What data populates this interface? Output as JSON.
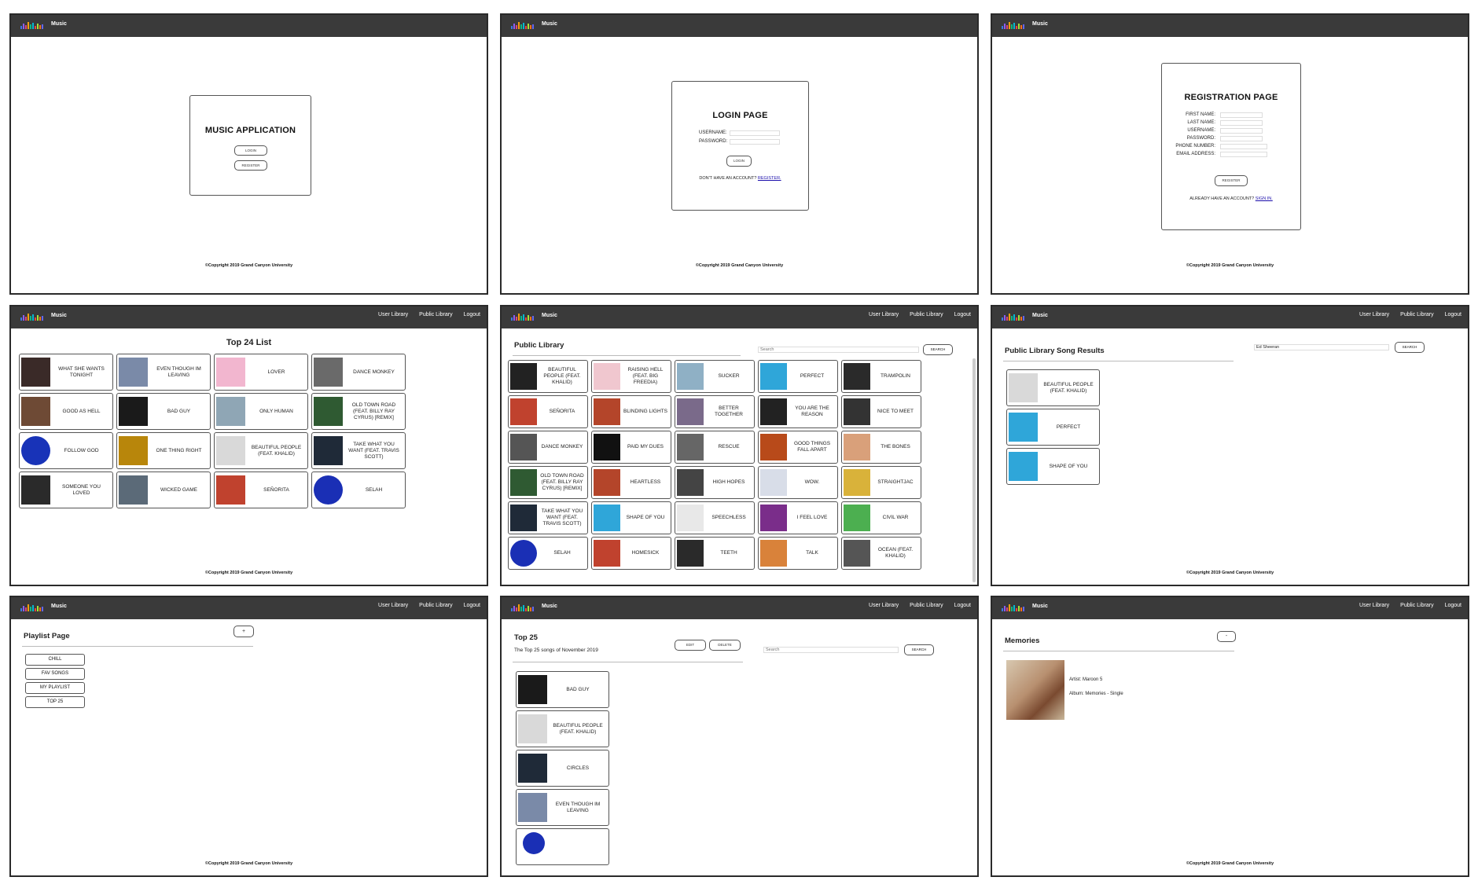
{
  "brand": "Music",
  "nav": [
    "User Library",
    "Public Library",
    "Logout"
  ],
  "footer": "©Copyright 2019 Grand Canyon University",
  "logo_colors": [
    "#3b7ae0",
    "#8b5cf6",
    "#e0457b",
    "#f59e0b",
    "#10b981",
    "#06b6d4",
    "#ef4444",
    "#a3e635",
    "#f97316",
    "#6366f1"
  ],
  "home": {
    "title": "MUSIC APPLICATION",
    "login": "LOGIN",
    "register": "REGISTER"
  },
  "login": {
    "title": "LOGIN PAGE",
    "fields": [
      "USERNAME:",
      "PASSWORD:"
    ],
    "button": "LOGIN",
    "note": "DON'T HAVE AN ACCOUNT?",
    "link": "REGISTER."
  },
  "registration": {
    "title": "REGISTRATION PAGE",
    "fields": [
      "FIRST NAME:",
      "LAST NAME:",
      "USERNAME:",
      "PASSWORD:",
      "PHONE NUMBER:",
      "EMAIL ADDRESS:"
    ],
    "button": "REGISTER",
    "note": "ALREADY HAVE AN ACCOUNT?",
    "link": "SIGN IN."
  },
  "top24": {
    "title": "Top 24 List",
    "songs": [
      {
        "name": "WHAT SHE WANTS TONIGHT",
        "color": "#3a2a28"
      },
      {
        "name": "EVEN THOUGH IM LEAVING",
        "color": "#7a8aa8"
      },
      {
        "name": "LOVER",
        "color": "#f2b6cf"
      },
      {
        "name": "DANCE MONKEY",
        "color": "#6a6a6a"
      },
      {
        "name": "GOOD AS HELL",
        "color": "#6e4a35"
      },
      {
        "name": "BAD GUY",
        "color": "#1a1a1a"
      },
      {
        "name": "ONLY HUMAN",
        "color": "#8fa6b5"
      },
      {
        "name": "OLD TOWN ROAD (FEAT. BILLY RAY CYRUS) [REMIX]",
        "color": "#2f5a32"
      },
      {
        "name": "FOLLOW GOD",
        "color": "#1833b8"
      },
      {
        "name": "ONE THING RIGHT",
        "color": "#b8860b"
      },
      {
        "name": "BEAUTIFUL PEOPLE (FEAT. KHALID)",
        "color": "#d9d9d9"
      },
      {
        "name": "TAKE WHAT YOU WANT (FEAT. TRAVIS SCOTT)",
        "color": "#1f2a38"
      },
      {
        "name": "SOMEONE YOU LOVED",
        "color": "#2a2a2a"
      },
      {
        "name": "WICKED GAME",
        "color": "#5b6a78"
      },
      {
        "name": "SEÑORITA",
        "color": "#c0422e"
      },
      {
        "name": "SELAH",
        "color": "#1a2fb5"
      }
    ]
  },
  "public_library": {
    "title": "Public Library",
    "search_placeholder": "Search",
    "search_button": "SEARCH",
    "songs": [
      {
        "name": "BEAUTIFUL PEOPLE (FEAT. KHALID)",
        "color": "#222"
      },
      {
        "name": "RAISING HELL (FEAT. BIG FREEDIA)",
        "color": "#f0c7cf"
      },
      {
        "name": "SUCKER",
        "color": "#8fb0c5"
      },
      {
        "name": "PERFECT",
        "color": "#2fa6d9"
      },
      {
        "name": "TRAMPOLIN",
        "color": "#2a2a2a"
      },
      {
        "name": "SEÑORITA",
        "color": "#c0422e"
      },
      {
        "name": "BLINDING LIGHTS",
        "color": "#b4452a"
      },
      {
        "name": "BETTER TOGETHER",
        "color": "#7a6a8a"
      },
      {
        "name": "YOU ARE THE REASON",
        "color": "#222"
      },
      {
        "name": "NICE TO MEET",
        "color": "#333"
      },
      {
        "name": "DANCE MONKEY",
        "color": "#555"
      },
      {
        "name": "PAID MY DUES",
        "color": "#111"
      },
      {
        "name": "RESCUE",
        "color": "#666"
      },
      {
        "name": "GOOD THINGS FALL APART",
        "color": "#b84a1a"
      },
      {
        "name": "THE BONES",
        "color": "#d9a07a"
      },
      {
        "name": "OLD TOWN ROAD (FEAT. BILLY RAY CYRUS) [REMIX]",
        "color": "#2f5a32"
      },
      {
        "name": "HEARTLESS",
        "color": "#b4452a"
      },
      {
        "name": "HIGH HOPES",
        "color": "#444"
      },
      {
        "name": "WOW.",
        "color": "#d8dde8"
      },
      {
        "name": "STRAIGHTJAC",
        "color": "#d9b23a"
      },
      {
        "name": "TAKE WHAT YOU WANT (FEAT. TRAVIS SCOTT)",
        "color": "#1f2a38"
      },
      {
        "name": "SHAPE OF YOU",
        "color": "#2fa6d9"
      },
      {
        "name": "SPEECHLESS",
        "color": "#e8e8e8"
      },
      {
        "name": "I FEEL LOVE",
        "color": "#7a2d8a"
      },
      {
        "name": "CIVIL WAR",
        "color": "#4caf50"
      },
      {
        "name": "SELAH",
        "color": "#1a2fb5"
      },
      {
        "name": "HOMESICK",
        "color": "#c0422e"
      },
      {
        "name": "TEETH",
        "color": "#2a2a2a"
      },
      {
        "name": "TALK",
        "color": "#d9823a"
      },
      {
        "name": "OCEAN (FEAT. KHALID)",
        "color": "#555"
      }
    ]
  },
  "song_results": {
    "title": "Public Library Song Results",
    "query": "Ed Sheeran",
    "search_button": "SEARCH",
    "songs": [
      {
        "name": "BEAUTIFUL PEOPLE (FEAT. KHALID)",
        "color": "#d9d9d9"
      },
      {
        "name": "PERFECT",
        "color": "#2fa6d9"
      },
      {
        "name": "SHAPE OF YOU",
        "color": "#2fa6d9"
      }
    ]
  },
  "playlist": {
    "title": "Playlist Page",
    "add": "+",
    "items": [
      "CHILL",
      "FAV SONGS",
      "MY PLAYLIST",
      "TOP 25"
    ]
  },
  "top25": {
    "title": "Top 25",
    "subtitle": "The Top 25 songs of November 2019",
    "edit": "EDIT",
    "delete": "DELETE",
    "search_placeholder": "Search",
    "search_button": "SEARCH",
    "songs": [
      {
        "name": "BAD GUY",
        "color": "#1a1a1a"
      },
      {
        "name": "BEAUTIFUL PEOPLE (FEAT. KHALID)",
        "color": "#d9d9d9"
      },
      {
        "name": "CIRCLES",
        "color": "#1f2a38"
      },
      {
        "name": "EVEN THOUGH IM LEAVING",
        "color": "#7a8aa8"
      }
    ]
  },
  "memories": {
    "title": "Memories",
    "add": "-",
    "artist": "Artist: Maroon 5",
    "album": "Album: Memories - Single"
  }
}
